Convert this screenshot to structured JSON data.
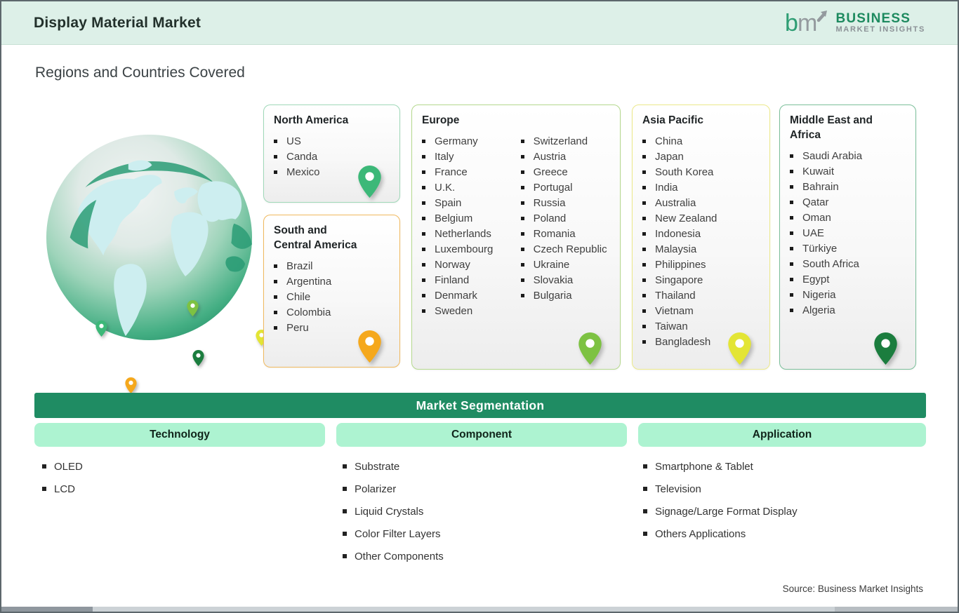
{
  "header": {
    "title": "Display Material Market",
    "logo": {
      "mark_b": "b",
      "mark_m": "m",
      "line1": "BUSINESS",
      "line2": "MARKET INSIGHTS"
    }
  },
  "section_title": "Regions and Countries Covered",
  "regions": [
    {
      "name": "North America",
      "countries": [
        "US",
        "Canda",
        "Mexico"
      ]
    },
    {
      "name": "South and Central America",
      "name_line1": "South and",
      "name_line2": "Central America",
      "countries": [
        "Brazil",
        "Argentina",
        "Chile",
        "Colombia",
        "Peru"
      ]
    },
    {
      "name": "Europe",
      "countries_col1": [
        "Germany",
        "Italy",
        "France",
        "U.K.",
        "Spain",
        "Belgium",
        "Netherlands",
        "Luxembourg",
        "Norway",
        "Finland",
        "Denmark",
        "Sweden"
      ],
      "countries_col2": [
        "Switzerland",
        "Austria",
        "Greece",
        "Portugal",
        "Russia",
        "Poland",
        "Romania",
        "Czech Republic",
        "Ukraine",
        "Slovakia",
        "Bulgaria"
      ]
    },
    {
      "name": "Asia Pacific",
      "countries": [
        "China",
        "Japan",
        "South Korea",
        "India",
        "Australia",
        "New Zealand",
        "Indonesia",
        "Malaysia",
        "Philippines",
        "Singapore",
        "Thailand",
        "Vietnam",
        "Taiwan",
        "Bangladesh"
      ]
    },
    {
      "name": "Middle East and Africa",
      "countries": [
        "Saudi Arabia",
        "Kuwait",
        "Bahrain",
        "Qatar",
        "Oman",
        "UAE",
        "Türkiye",
        "South Africa",
        "Egypt",
        "Nigeria",
        "Algeria"
      ]
    }
  ],
  "segmentation": {
    "title": "Market Segmentation",
    "columns": [
      {
        "label": "Technology",
        "items": [
          "OLED",
          "LCD"
        ]
      },
      {
        "label": "Component",
        "items": [
          "Substrate",
          "Polarizer",
          "Liquid Crystals",
          "Color Filter Layers",
          "Other Components"
        ]
      },
      {
        "label": "Application",
        "items": [
          "Smartphone & Tablet",
          "Television",
          "Signage/Large Format Display",
          "Others Applications"
        ]
      }
    ]
  },
  "source": "Source: Business Market Insights",
  "colors": {
    "header_band": "#ddf0e8",
    "segmentation_bar": "#1f8c63",
    "segment_pill": "#adf3d1",
    "north_america_pin": "#3cb878",
    "south_central_america_pin": "#f5a81c",
    "europe_pin": "#7dc242",
    "asia_pacific_pin": "#e3e535",
    "middle_east_africa_pin": "#1b7d3e",
    "north_america_border": "#9fd8b8",
    "south_central_america_border": "#f0b95e",
    "europe_border": "#b5d98e",
    "asia_pacific_border": "#ece98b",
    "middle_east_africa_border": "#7bbf9a",
    "logo_green": "#2f9e74",
    "logo_gray": "#949a9e"
  }
}
